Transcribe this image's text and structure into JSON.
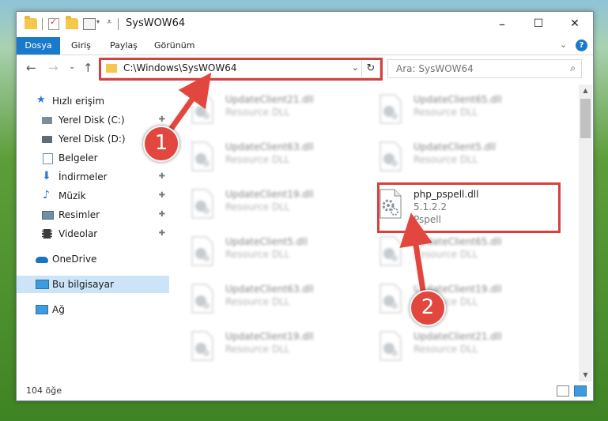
{
  "window": {
    "title": "SysWOW64",
    "minimize": "–",
    "maximize": "☐",
    "close": "✕"
  },
  "ribbon": {
    "tabs": [
      "Dosya",
      "Giriş",
      "Paylaş",
      "Görünüm"
    ],
    "expand": "⌄",
    "help": "?"
  },
  "navigation": {
    "back": "←",
    "forward": "→",
    "recent": "⌄",
    "up": "↑",
    "address": "C:\\Windows\\SysWOW64",
    "address_dropdown": "⌄",
    "refresh": "↻",
    "search_placeholder": "Ara: SysWOW64",
    "search_icon": "search-icon"
  },
  "sidebar": {
    "items": [
      {
        "label": "Hızlı erişim",
        "icon": "star-icon",
        "pinned": false
      },
      {
        "label": "Yerel Disk (C:)",
        "icon": "drive-icon",
        "pinned": true
      },
      {
        "label": "Yerel Disk (D:)",
        "icon": "drive-icon",
        "pinned": true
      },
      {
        "label": "Belgeler",
        "icon": "documents-icon",
        "pinned": true
      },
      {
        "label": "İndirmeler",
        "icon": "downloads-icon",
        "pinned": true
      },
      {
        "label": "Müzik",
        "icon": "music-icon",
        "pinned": true
      },
      {
        "label": "Resimler",
        "icon": "pictures-icon",
        "pinned": true
      },
      {
        "label": "Videolar",
        "icon": "videos-icon",
        "pinned": true
      },
      {
        "label": "OneDrive",
        "icon": "cloud-icon",
        "pinned": false
      },
      {
        "label": "Bu bilgisayar",
        "icon": "computer-icon",
        "pinned": false
      },
      {
        "label": "Ağ",
        "icon": "network-icon",
        "pinned": false
      }
    ],
    "pin_glyph": "📌"
  },
  "files": {
    "left": [
      {
        "name": "UpdateClient21.dll",
        "line1": "Resource DLL"
      },
      {
        "name": "UpdateClient63.dll",
        "line1": "Resource DLL"
      },
      {
        "name": "UpdateClient19.dll",
        "line1": "Resource DLL"
      },
      {
        "name": "UpdateClient5.dll",
        "line1": "Resource DLL"
      },
      {
        "name": "UpdateClient63.dll",
        "line1": "Resource DLL"
      },
      {
        "name": "UpdateClient19.dll",
        "line1": "Resource DLL"
      }
    ],
    "right": [
      {
        "name": "UpdateClient65.dll",
        "line1": "Resource DLL"
      },
      {
        "name": "UpdateClient5.dll",
        "line1": "Resource DLL"
      },
      {
        "name": "php_pspell.dll",
        "line1": "5.1.2.2",
        "line2": "Pspell",
        "highlighted": true
      },
      {
        "name": "UpdateClient65.dll",
        "line1": "Resource DLL"
      },
      {
        "name": "UpdateClient19.dll",
        "line1": "Resource DLL"
      },
      {
        "name": "UpdateClient21.dll",
        "line1": "Resource DLL"
      }
    ]
  },
  "status": {
    "item_count": "104 öğe"
  },
  "callouts": [
    {
      "number": "1"
    },
    {
      "number": "2"
    }
  ],
  "colors": {
    "accent": "#1979ca",
    "callout": "#e2473f",
    "highlight_border": "#d84040"
  }
}
